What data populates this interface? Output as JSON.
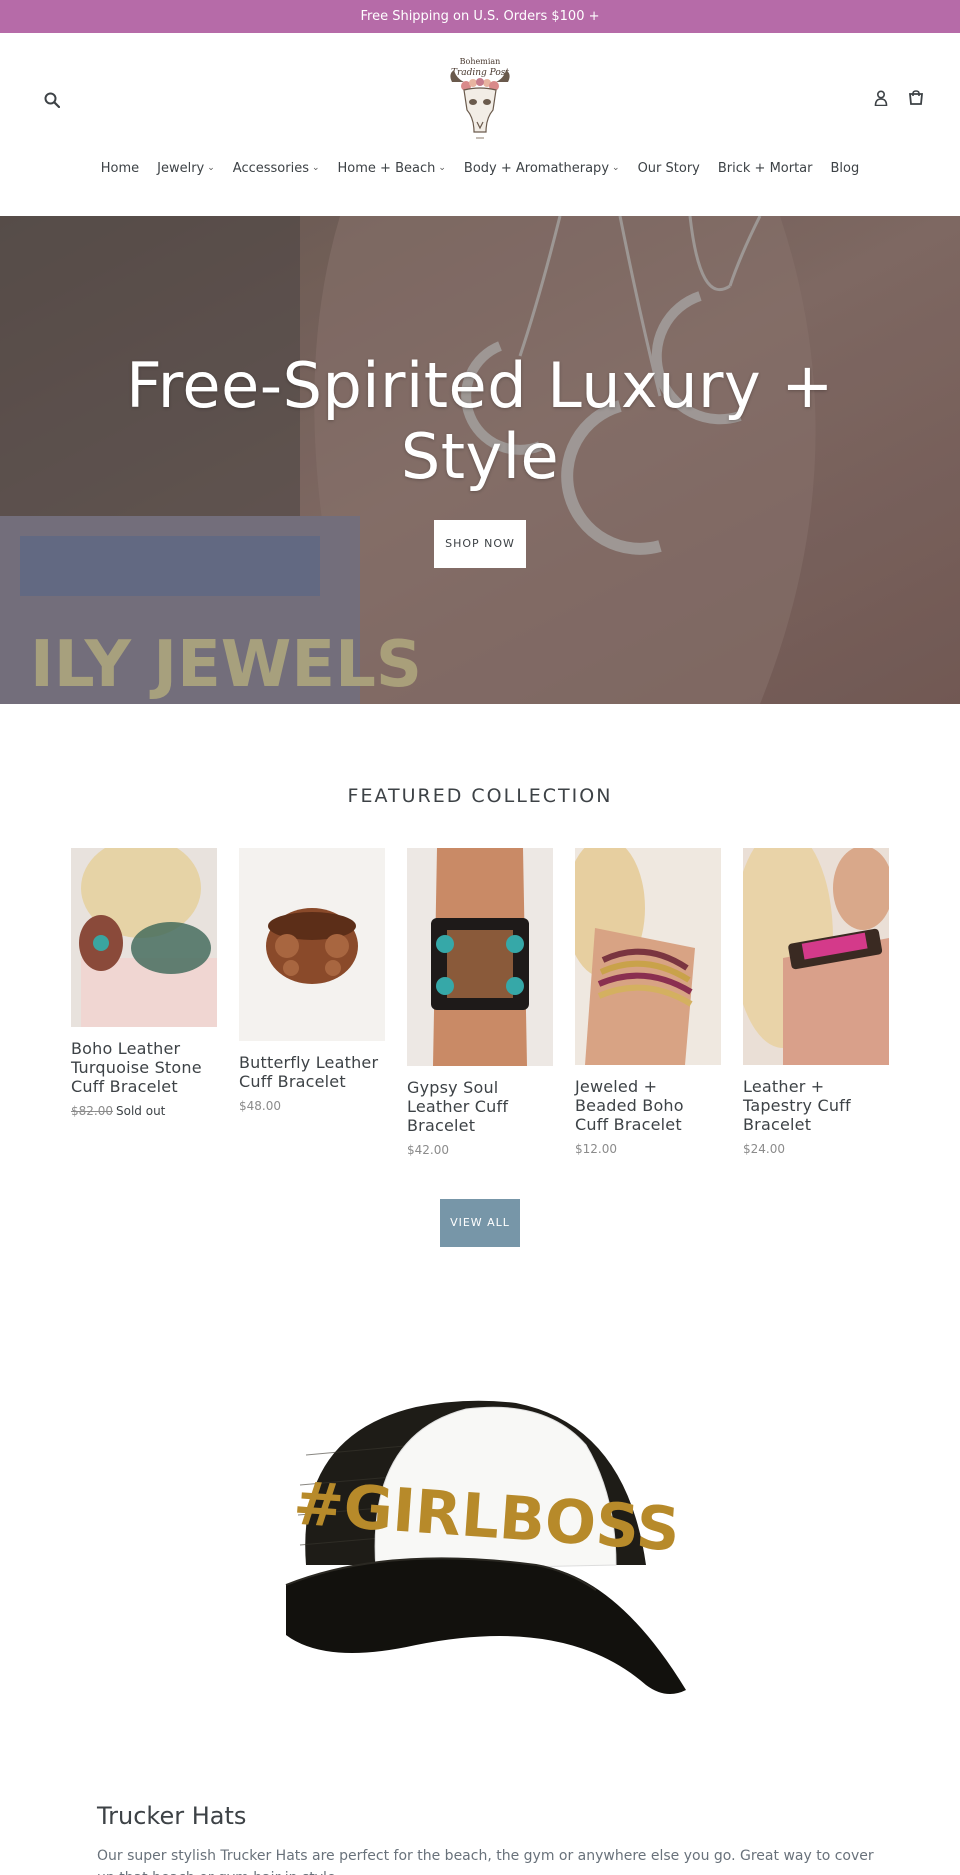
{
  "announcement": "Free Shipping on U.S. Orders $100 +",
  "header": {
    "logo_text_top": "Bohemian",
    "logo_text_script": "Trading Post"
  },
  "nav": [
    {
      "label": "Home",
      "dropdown": false
    },
    {
      "label": "Jewelry",
      "dropdown": true
    },
    {
      "label": "Accessories",
      "dropdown": true
    },
    {
      "label": "Home + Beach",
      "dropdown": true
    },
    {
      "label": "Body + Aromatherapy",
      "dropdown": true
    },
    {
      "label": "Our Story",
      "dropdown": false
    },
    {
      "label": "Brick + Mortar",
      "dropdown": false
    },
    {
      "label": "Blog",
      "dropdown": false
    }
  ],
  "hero": {
    "title": "Free-Spirited Luxury + Style",
    "button": "SHOP NOW",
    "image_text": "ILY JEWELS"
  },
  "featured": {
    "title": "FEATURED COLLECTION",
    "products": [
      {
        "name": "Boho Leather Turquoise Stone Cuff Bracelet",
        "price": "$82.00",
        "status": "Sold out"
      },
      {
        "name": "Butterfly Leather Cuff Bracelet",
        "price": "$48.00"
      },
      {
        "name": "Gypsy Soul Leather Cuff Bracelet",
        "price": "$42.00"
      },
      {
        "name": "Jeweled + Beaded Boho Cuff Bracelet",
        "price": "$12.00"
      },
      {
        "name": "Leather + Tapestry Cuff Bracelet",
        "price": "$24.00"
      }
    ],
    "view_all": "VIEW ALL"
  },
  "feature_block": {
    "hat_text": "#GIRLBOSS",
    "title": "Trucker Hats",
    "text": "Our super stylish Trucker Hats are perfect for the beach, the gym or anywhere else you go.  Great way to cover up that beach or gym hair in style."
  },
  "colors": {
    "announcement_bg": "#b66ba8",
    "button_bg": "#7796a8",
    "text": "#3d4246"
  }
}
